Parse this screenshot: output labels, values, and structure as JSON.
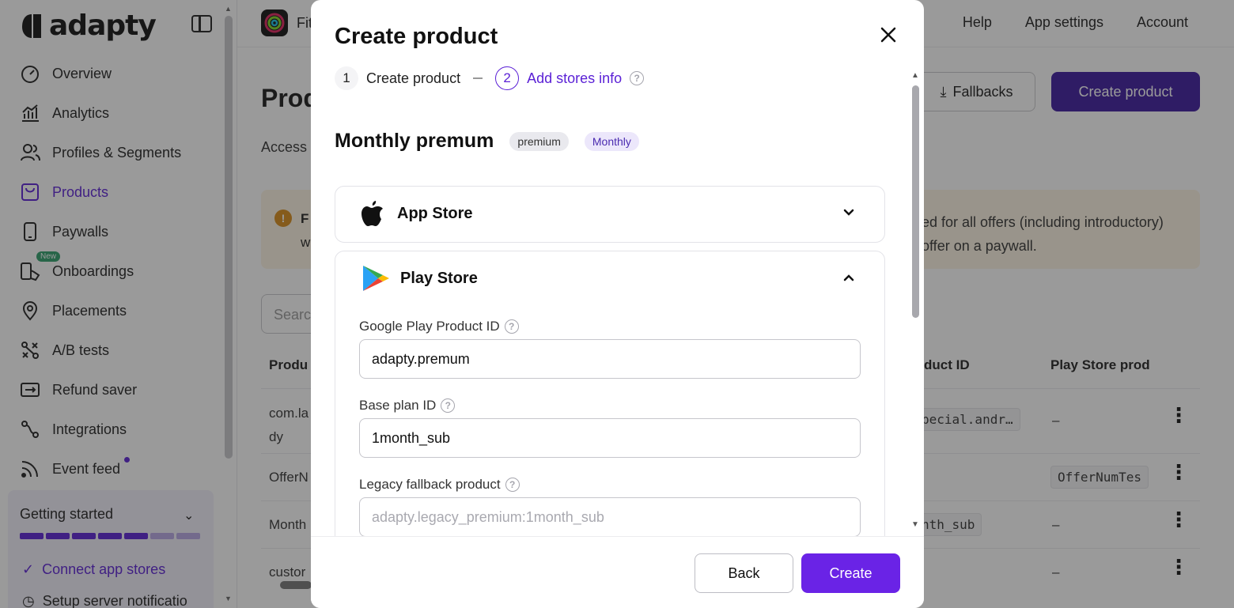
{
  "sidebar": {
    "logo_text": "adapty",
    "items": [
      {
        "label": "Overview",
        "icon": "gauge-icon"
      },
      {
        "label": "Analytics",
        "icon": "chart-icon"
      },
      {
        "label": "Profiles & Segments",
        "icon": "users-icon"
      },
      {
        "label": "Products",
        "icon": "bag-icon",
        "active": true
      },
      {
        "label": "Paywalls",
        "icon": "phone-icon"
      },
      {
        "label": "Onboardings",
        "icon": "touch-icon",
        "badge": "New"
      },
      {
        "label": "Placements",
        "icon": "pin-icon"
      },
      {
        "label": "A/B tests",
        "icon": "split-icon"
      },
      {
        "label": "Refund saver",
        "icon": "refund-icon"
      },
      {
        "label": "Integrations",
        "icon": "plug-icon"
      },
      {
        "label": "Event feed",
        "icon": "rss-icon"
      }
    ],
    "getting_started": {
      "title": "Getting started",
      "progress_done": 5,
      "progress_total": 7,
      "items": [
        "Connect app stores",
        "Setup server notificatio"
      ]
    }
  },
  "topbar": {
    "app_name": "Fit",
    "links": [
      "Help",
      "App settings",
      "Account"
    ]
  },
  "page": {
    "title": "Prod",
    "tab": "Access",
    "fallbacks_label": "Fallbacks",
    "create_product_label": "Create product",
    "notice_prefix": "F",
    "notice_prefix2": "w",
    "notice_line1": "ed for all offers (including introductory)",
    "notice_line2": "offer on a paywall.",
    "search_placeholder": "Searc",
    "columns": [
      "Produ",
      "duct ID",
      "Play Store prod"
    ],
    "rows": [
      {
        "name1": "com.la",
        "name2": "dy",
        "app_store_id": "pecial.andr…",
        "play_store_id": "–"
      },
      {
        "name1": "OfferN",
        "app_store_id": "",
        "play_store_id": "OfferNumTes"
      },
      {
        "name1": "Month",
        "app_store_id": "nth_sub",
        "play_store_id": "–"
      },
      {
        "name1": "custor",
        "app_store_id": "",
        "play_store_id": "–"
      }
    ]
  },
  "modal": {
    "title": "Create product",
    "steps": [
      {
        "num": "1",
        "label": "Create product"
      },
      {
        "num": "2",
        "label": "Add stores info"
      }
    ],
    "product_name": "Monthly premum",
    "tags": [
      "premium",
      "Monthly"
    ],
    "app_store": {
      "label": "App Store",
      "expanded": false
    },
    "play_store": {
      "label": "Play Store",
      "expanded": true,
      "product_id_label": "Google Play Product ID",
      "product_id_value": "adapty.premum",
      "base_plan_label": "Base plan ID",
      "base_plan_value": "1month_sub",
      "legacy_label": "Legacy fallback product",
      "legacy_placeholder": "adapty.legacy_premium:1month_sub"
    },
    "back_label": "Back",
    "create_label": "Create"
  },
  "colors": {
    "accent": "#5b21d6",
    "create_button": "#6a23e6",
    "header_button": "#3d1a9e"
  }
}
